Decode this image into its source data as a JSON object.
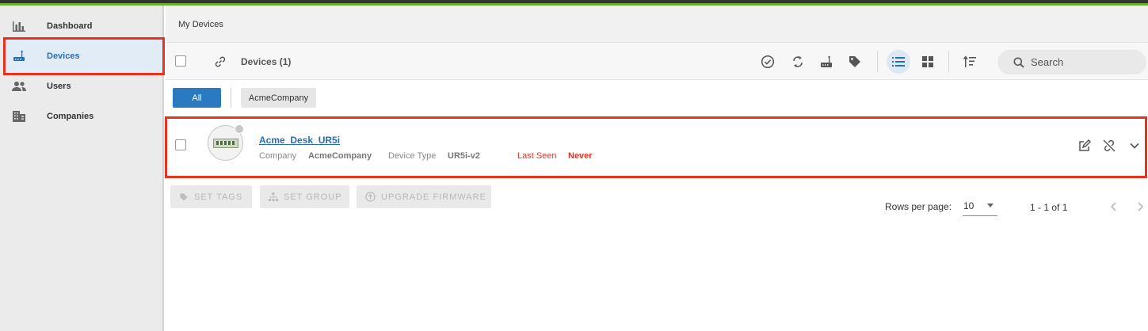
{
  "sidebar": {
    "items": [
      {
        "label": "Dashboard",
        "icon": "bar-chart-icon"
      },
      {
        "label": "Devices",
        "icon": "router-icon"
      },
      {
        "label": "Users",
        "icon": "users-icon"
      },
      {
        "label": "Companies",
        "icon": "building-icon"
      }
    ]
  },
  "breadcrumb": "My Devices",
  "toolbar": {
    "title": "Devices (1)",
    "search_placeholder": "Search"
  },
  "filters": {
    "all_label": "All",
    "company_label": "AcmeCompany"
  },
  "device": {
    "name": "Acme_Desk_UR5i",
    "company_label": "Company",
    "company_value": "AcmeCompany",
    "type_label": "Device Type",
    "type_value": "UR5i-v2",
    "last_seen_label": "Last Seen",
    "last_seen_value": "Never"
  },
  "actions": {
    "set_tags": "SET TAGS",
    "set_group": "SET GROUP",
    "upgrade_firmware": "UPGRADE FIRMWARE"
  },
  "pagination": {
    "rows_label": "Rows per page:",
    "rows_value": "10",
    "range": "1 - 1 of 1"
  },
  "colors": {
    "accent": "#2a7ac2",
    "highlight": "#e8321e",
    "topbar_green": "#6ab42d"
  }
}
